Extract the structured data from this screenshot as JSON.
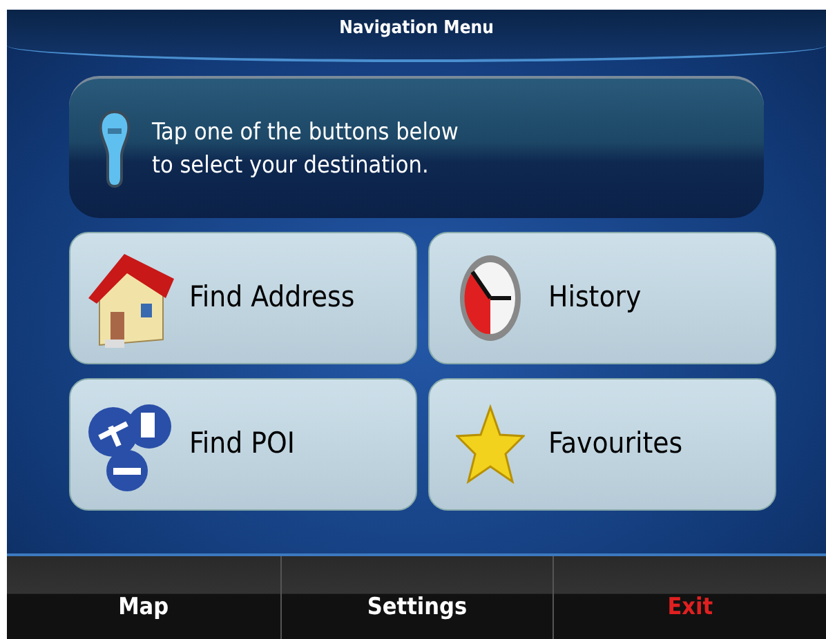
{
  "window": {
    "title": "Navigation Menu"
  },
  "hint": {
    "text": "Tap one of the buttons below\nto select your destination."
  },
  "menu": [
    {
      "label": "Find Address",
      "kind": "house"
    },
    {
      "label": "History",
      "kind": "clock"
    },
    {
      "label": "Find POI",
      "kind": "poi"
    },
    {
      "label": "Favourites",
      "kind": "star"
    }
  ],
  "bottom_bar": [
    {
      "label": "Map",
      "kind": "normal"
    },
    {
      "label": "Settings",
      "kind": "normal"
    },
    {
      "label": "Exit",
      "kind": "danger"
    }
  ]
}
